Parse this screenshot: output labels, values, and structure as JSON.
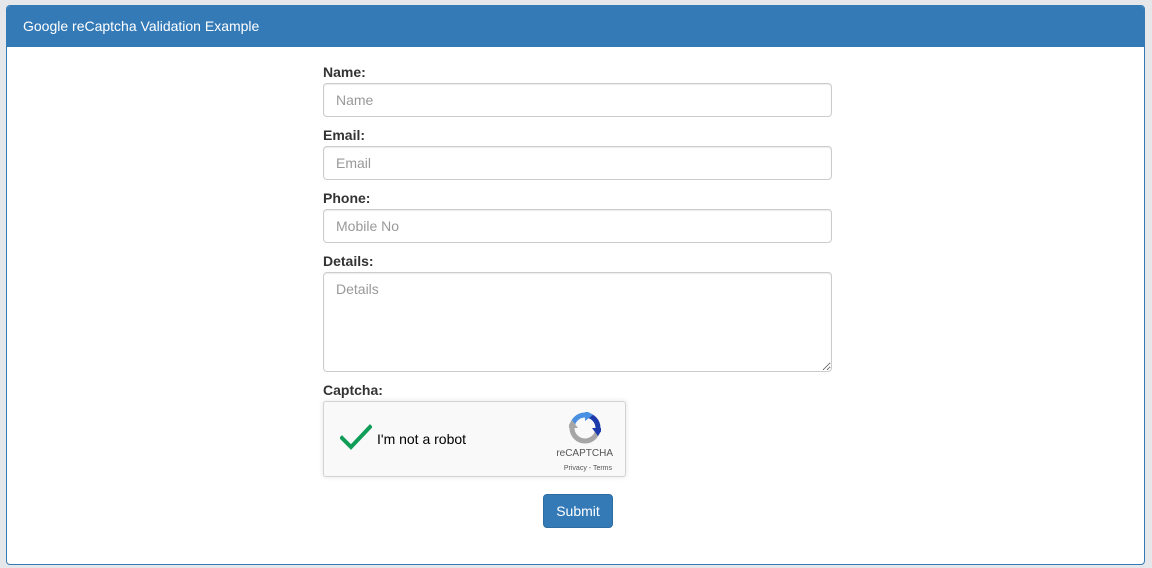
{
  "panel": {
    "title": "Google reCaptcha Validation Example"
  },
  "form": {
    "name": {
      "label": "Name:",
      "placeholder": "Name",
      "value": ""
    },
    "email": {
      "label": "Email:",
      "placeholder": "Email",
      "value": ""
    },
    "phone": {
      "label": "Phone:",
      "placeholder": "Mobile No",
      "value": ""
    },
    "details": {
      "label": "Details:",
      "placeholder": "Details",
      "value": ""
    },
    "captcha": {
      "label": "Captcha:",
      "checkbox_text": "I'm not a robot",
      "checked": true,
      "brand": "reCAPTCHA",
      "privacy": "Privacy",
      "separator": " - ",
      "terms": "Terms"
    },
    "submit_label": "Submit"
  },
  "colors": {
    "primary": "#337ab7",
    "check": "#0f9d58",
    "page_bg": "#e6e7ea"
  },
  "icons": {
    "checkmark": "checkmark-icon",
    "recaptcha": "recaptcha-logo-icon"
  }
}
